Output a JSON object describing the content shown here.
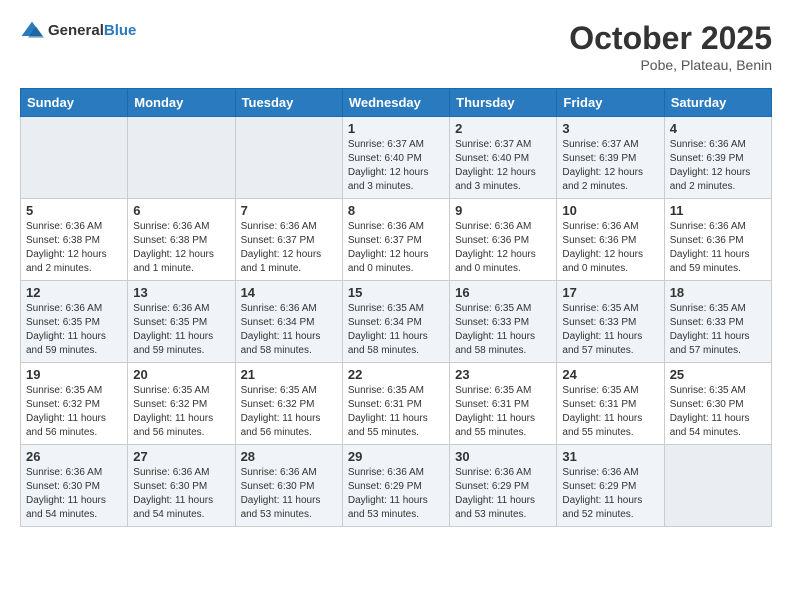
{
  "header": {
    "logo_line1": "General",
    "logo_line2": "Blue",
    "month": "October 2025",
    "location": "Pobe, Plateau, Benin"
  },
  "weekdays": [
    "Sunday",
    "Monday",
    "Tuesday",
    "Wednesday",
    "Thursday",
    "Friday",
    "Saturday"
  ],
  "weeks": [
    [
      {
        "day": "",
        "sunrise": "",
        "sunset": "",
        "daylight": ""
      },
      {
        "day": "",
        "sunrise": "",
        "sunset": "",
        "daylight": ""
      },
      {
        "day": "",
        "sunrise": "",
        "sunset": "",
        "daylight": ""
      },
      {
        "day": "1",
        "sunrise": "Sunrise: 6:37 AM",
        "sunset": "Sunset: 6:40 PM",
        "daylight": "Daylight: 12 hours and 3 minutes."
      },
      {
        "day": "2",
        "sunrise": "Sunrise: 6:37 AM",
        "sunset": "Sunset: 6:40 PM",
        "daylight": "Daylight: 12 hours and 3 minutes."
      },
      {
        "day": "3",
        "sunrise": "Sunrise: 6:37 AM",
        "sunset": "Sunset: 6:39 PM",
        "daylight": "Daylight: 12 hours and 2 minutes."
      },
      {
        "day": "4",
        "sunrise": "Sunrise: 6:36 AM",
        "sunset": "Sunset: 6:39 PM",
        "daylight": "Daylight: 12 hours and 2 minutes."
      }
    ],
    [
      {
        "day": "5",
        "sunrise": "Sunrise: 6:36 AM",
        "sunset": "Sunset: 6:38 PM",
        "daylight": "Daylight: 12 hours and 2 minutes."
      },
      {
        "day": "6",
        "sunrise": "Sunrise: 6:36 AM",
        "sunset": "Sunset: 6:38 PM",
        "daylight": "Daylight: 12 hours and 1 minute."
      },
      {
        "day": "7",
        "sunrise": "Sunrise: 6:36 AM",
        "sunset": "Sunset: 6:37 PM",
        "daylight": "Daylight: 12 hours and 1 minute."
      },
      {
        "day": "8",
        "sunrise": "Sunrise: 6:36 AM",
        "sunset": "Sunset: 6:37 PM",
        "daylight": "Daylight: 12 hours and 0 minutes."
      },
      {
        "day": "9",
        "sunrise": "Sunrise: 6:36 AM",
        "sunset": "Sunset: 6:36 PM",
        "daylight": "Daylight: 12 hours and 0 minutes."
      },
      {
        "day": "10",
        "sunrise": "Sunrise: 6:36 AM",
        "sunset": "Sunset: 6:36 PM",
        "daylight": "Daylight: 12 hours and 0 minutes."
      },
      {
        "day": "11",
        "sunrise": "Sunrise: 6:36 AM",
        "sunset": "Sunset: 6:36 PM",
        "daylight": "Daylight: 11 hours and 59 minutes."
      }
    ],
    [
      {
        "day": "12",
        "sunrise": "Sunrise: 6:36 AM",
        "sunset": "Sunset: 6:35 PM",
        "daylight": "Daylight: 11 hours and 59 minutes."
      },
      {
        "day": "13",
        "sunrise": "Sunrise: 6:36 AM",
        "sunset": "Sunset: 6:35 PM",
        "daylight": "Daylight: 11 hours and 59 minutes."
      },
      {
        "day": "14",
        "sunrise": "Sunrise: 6:36 AM",
        "sunset": "Sunset: 6:34 PM",
        "daylight": "Daylight: 11 hours and 58 minutes."
      },
      {
        "day": "15",
        "sunrise": "Sunrise: 6:35 AM",
        "sunset": "Sunset: 6:34 PM",
        "daylight": "Daylight: 11 hours and 58 minutes."
      },
      {
        "day": "16",
        "sunrise": "Sunrise: 6:35 AM",
        "sunset": "Sunset: 6:33 PM",
        "daylight": "Daylight: 11 hours and 58 minutes."
      },
      {
        "day": "17",
        "sunrise": "Sunrise: 6:35 AM",
        "sunset": "Sunset: 6:33 PM",
        "daylight": "Daylight: 11 hours and 57 minutes."
      },
      {
        "day": "18",
        "sunrise": "Sunrise: 6:35 AM",
        "sunset": "Sunset: 6:33 PM",
        "daylight": "Daylight: 11 hours and 57 minutes."
      }
    ],
    [
      {
        "day": "19",
        "sunrise": "Sunrise: 6:35 AM",
        "sunset": "Sunset: 6:32 PM",
        "daylight": "Daylight: 11 hours and 56 minutes."
      },
      {
        "day": "20",
        "sunrise": "Sunrise: 6:35 AM",
        "sunset": "Sunset: 6:32 PM",
        "daylight": "Daylight: 11 hours and 56 minutes."
      },
      {
        "day": "21",
        "sunrise": "Sunrise: 6:35 AM",
        "sunset": "Sunset: 6:32 PM",
        "daylight": "Daylight: 11 hours and 56 minutes."
      },
      {
        "day": "22",
        "sunrise": "Sunrise: 6:35 AM",
        "sunset": "Sunset: 6:31 PM",
        "daylight": "Daylight: 11 hours and 55 minutes."
      },
      {
        "day": "23",
        "sunrise": "Sunrise: 6:35 AM",
        "sunset": "Sunset: 6:31 PM",
        "daylight": "Daylight: 11 hours and 55 minutes."
      },
      {
        "day": "24",
        "sunrise": "Sunrise: 6:35 AM",
        "sunset": "Sunset: 6:31 PM",
        "daylight": "Daylight: 11 hours and 55 minutes."
      },
      {
        "day": "25",
        "sunrise": "Sunrise: 6:35 AM",
        "sunset": "Sunset: 6:30 PM",
        "daylight": "Daylight: 11 hours and 54 minutes."
      }
    ],
    [
      {
        "day": "26",
        "sunrise": "Sunrise: 6:36 AM",
        "sunset": "Sunset: 6:30 PM",
        "daylight": "Daylight: 11 hours and 54 minutes."
      },
      {
        "day": "27",
        "sunrise": "Sunrise: 6:36 AM",
        "sunset": "Sunset: 6:30 PM",
        "daylight": "Daylight: 11 hours and 54 minutes."
      },
      {
        "day": "28",
        "sunrise": "Sunrise: 6:36 AM",
        "sunset": "Sunset: 6:30 PM",
        "daylight": "Daylight: 11 hours and 53 minutes."
      },
      {
        "day": "29",
        "sunrise": "Sunrise: 6:36 AM",
        "sunset": "Sunset: 6:29 PM",
        "daylight": "Daylight: 11 hours and 53 minutes."
      },
      {
        "day": "30",
        "sunrise": "Sunrise: 6:36 AM",
        "sunset": "Sunset: 6:29 PM",
        "daylight": "Daylight: 11 hours and 53 minutes."
      },
      {
        "day": "31",
        "sunrise": "Sunrise: 6:36 AM",
        "sunset": "Sunset: 6:29 PM",
        "daylight": "Daylight: 11 hours and 52 minutes."
      },
      {
        "day": "",
        "sunrise": "",
        "sunset": "",
        "daylight": ""
      }
    ]
  ]
}
